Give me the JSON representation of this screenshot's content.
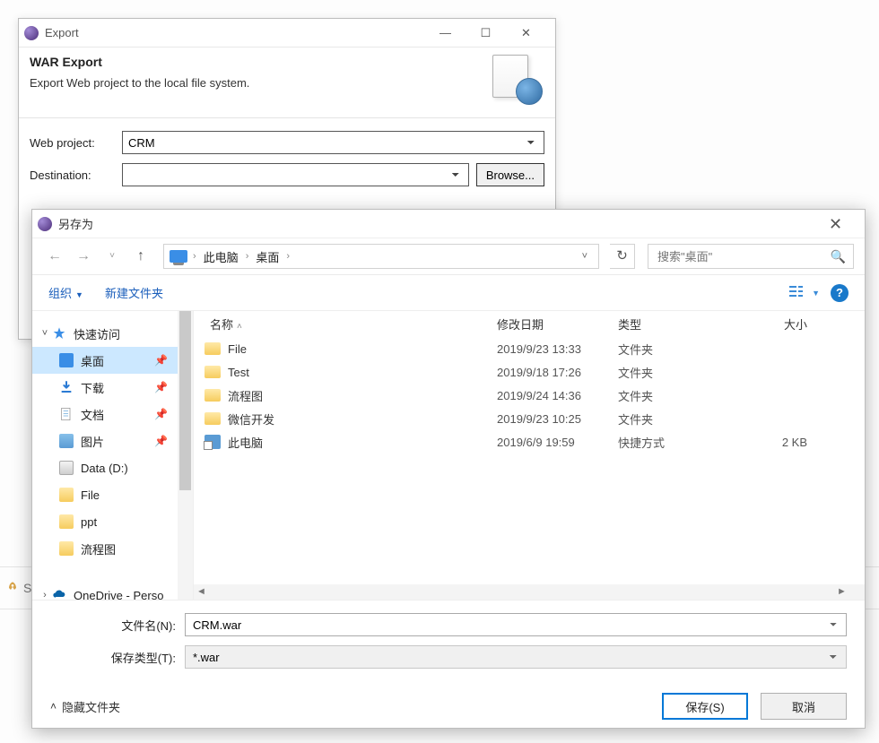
{
  "export": {
    "title": "Export",
    "heading": "WAR Export",
    "subtitle": "Export Web project to the local file system.",
    "web_project_label": "Web project:",
    "web_project_value": "CRM",
    "destination_label": "Destination:",
    "destination_value": "",
    "browse_label": "Browse..."
  },
  "windowchrome": {
    "min": "—",
    "max": "☐",
    "close": "✕"
  },
  "footer": {
    "partial": "S"
  },
  "saveas": {
    "title": "另存为",
    "breadcrumb": {
      "root": "此电脑",
      "folder": "桌面"
    },
    "search_placeholder": "搜索\"桌面\"",
    "toolbar": {
      "organize": "组织",
      "new_folder": "新建文件夹"
    },
    "tree": {
      "quick": "快速访问",
      "items": [
        {
          "label": "桌面",
          "pin": true,
          "selected": true,
          "icon": "desktop"
        },
        {
          "label": "下载",
          "pin": true,
          "icon": "download"
        },
        {
          "label": "文档",
          "pin": true,
          "icon": "doc"
        },
        {
          "label": "图片",
          "pin": true,
          "icon": "pic"
        },
        {
          "label": "Data (D:)",
          "icon": "drive"
        },
        {
          "label": "File",
          "icon": "folder"
        },
        {
          "label": "ppt",
          "icon": "folder"
        },
        {
          "label": "流程图",
          "icon": "folder"
        }
      ],
      "onedrive": "OneDrive - Perso"
    },
    "columns": {
      "name": "名称",
      "date": "修改日期",
      "type": "类型",
      "size": "大小"
    },
    "rows": [
      {
        "name": "File",
        "date": "2019/9/23 13:33",
        "type": "文件夹",
        "size": "",
        "icon": "folder"
      },
      {
        "name": "Test",
        "date": "2019/9/18 17:26",
        "type": "文件夹",
        "size": "",
        "icon": "folder"
      },
      {
        "name": "流程图",
        "date": "2019/9/24 14:36",
        "type": "文件夹",
        "size": "",
        "icon": "folder"
      },
      {
        "name": "微信开发",
        "date": "2019/9/23 10:25",
        "type": "文件夹",
        "size": "",
        "icon": "folder"
      },
      {
        "name": "此电脑",
        "date": "2019/6/9 19:59",
        "type": "快捷方式",
        "size": "2 KB",
        "icon": "shortcut"
      }
    ],
    "filename_label": "文件名(N):",
    "filename_value": "CRM.war",
    "filetype_label": "保存类型(T):",
    "filetype_value": "*.war",
    "hide_folders": "隐藏文件夹",
    "save_btn": "保存(S)",
    "cancel_btn": "取消"
  }
}
